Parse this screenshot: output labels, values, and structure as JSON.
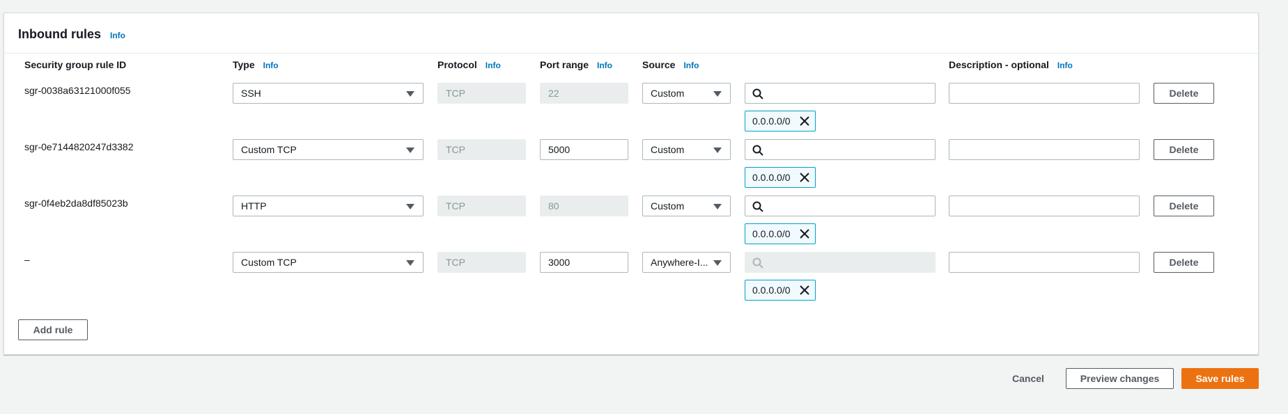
{
  "panel": {
    "title": "Inbound rules",
    "info_label": "Info"
  },
  "columns": {
    "rule_id": "Security group rule ID",
    "type": "Type",
    "protocol": "Protocol",
    "port_range": "Port range",
    "source": "Source",
    "description": "Description - optional",
    "info_label": "Info"
  },
  "rules": [
    {
      "rule_id": "sgr-0038a63121000f055",
      "type": "SSH",
      "protocol": "TCP",
      "port_range": "22",
      "port_editable": false,
      "source": "Custom",
      "search_value": "",
      "search_disabled": false,
      "cidr": "0.0.0.0/0",
      "description": "",
      "delete_label": "Delete"
    },
    {
      "rule_id": "sgr-0e7144820247d3382",
      "type": "Custom TCP",
      "protocol": "TCP",
      "port_range": "5000",
      "port_editable": true,
      "source": "Custom",
      "search_value": "",
      "search_disabled": false,
      "cidr": "0.0.0.0/0",
      "description": "",
      "delete_label": "Delete"
    },
    {
      "rule_id": "sgr-0f4eb2da8df85023b",
      "type": "HTTP",
      "protocol": "TCP",
      "port_range": "80",
      "port_editable": false,
      "source": "Custom",
      "search_value": "",
      "search_disabled": false,
      "cidr": "0.0.0.0/0",
      "description": "",
      "delete_label": "Delete"
    },
    {
      "rule_id": "–",
      "type": "Custom TCP",
      "protocol": "TCP",
      "port_range": "3000",
      "port_editable": true,
      "source": "Anywhere-I...",
      "search_value": "",
      "search_disabled": true,
      "cidr": "0.0.0.0/0",
      "description": "",
      "delete_label": "Delete"
    }
  ],
  "buttons": {
    "add_rule": "Add rule",
    "cancel": "Cancel",
    "preview_changes": "Preview changes",
    "save_rules": "Save rules"
  },
  "colors": {
    "primary": "#ec7211",
    "link": "#0073bb",
    "token_border": "#00a1c9"
  },
  "icons": {
    "dropdown": "caret-down-icon",
    "search": "search-icon",
    "remove_token": "close-icon"
  }
}
